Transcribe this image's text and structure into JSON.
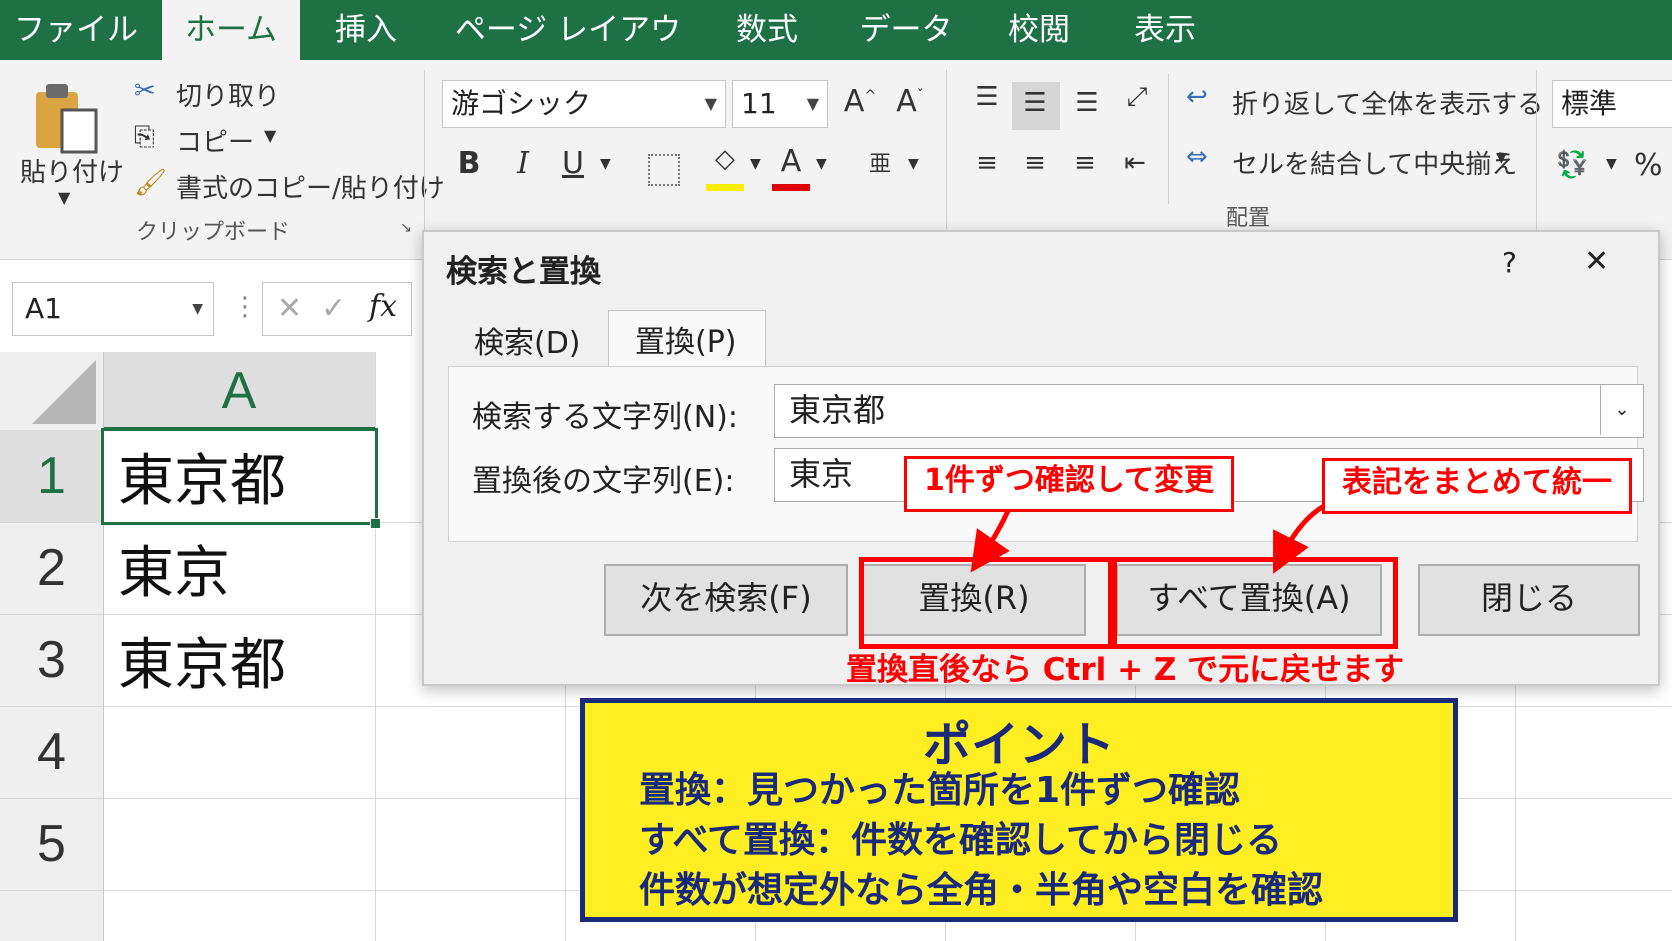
{
  "menu_tabs": [
    "ファイル",
    "ホーム",
    "挿入",
    "ページ レイアウト",
    "数式",
    "データ",
    "校閲",
    "表示"
  ],
  "ribbon": {
    "paste_label": "貼り付け",
    "cut_label": "切り取り",
    "copy_label": "コピー",
    "format_painter_label": "書式のコピー/貼り付け",
    "clipboard_group": "クリップボード",
    "font_name": "游ゴシック",
    "font_size": "11",
    "wrap_text_label": "折り返して全体を表示する",
    "merge_center_label": "セルを結合して中央揃え",
    "alignment_group": "配置",
    "number_format": "標準",
    "percent": "%"
  },
  "formula_bar": {
    "name_box": "A1",
    "fx": "fx"
  },
  "sheet": {
    "column_header": "A",
    "rows": [
      {
        "num": "1",
        "a": "東京都"
      },
      {
        "num": "2",
        "a": "東京"
      },
      {
        "num": "3",
        "a": "東京都"
      },
      {
        "num": "4",
        "a": ""
      },
      {
        "num": "5",
        "a": ""
      }
    ]
  },
  "dialog": {
    "title": "検索と置換",
    "help": "?",
    "close_x": "✕",
    "tab_find": "検索(D)",
    "tab_replace": "置換(P)",
    "find_label": "検索する文字列(N):",
    "find_value": "東京都",
    "replace_label": "置換後の文字列(E):",
    "replace_value": "東京",
    "btn_find_next": "次を検索(F)",
    "btn_replace": "置換(R)",
    "btn_replace_all": "すべて置換(A)",
    "btn_close": "閉じる"
  },
  "annotations": {
    "callout_replace": "1件ずつ確認して変更",
    "callout_replace_all": "表記をまとめて統一",
    "undo_note": "置換直後なら Ctrl + Z で元に戻せます"
  },
  "point_box": {
    "title": "ポイント",
    "lines": [
      "置換：見つかった箇所を1件ずつ確認",
      "すべて置換：件数を確認してから閉じる",
      "件数が想定外なら全角・半角や空白を確認"
    ]
  },
  "colors": {
    "excel_green": "#1e7145",
    "highlight_red": "#ff0000",
    "point_yellow": "#ffee22",
    "point_navy": "#1a2a7a"
  }
}
